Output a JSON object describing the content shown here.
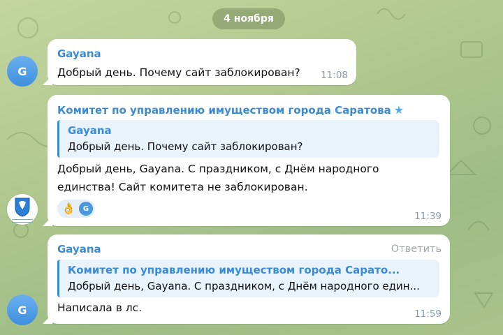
{
  "chat": {
    "date_separator": "4 ноября",
    "messages": [
      {
        "avatar_letter": "G",
        "sender": "Gayana",
        "text": "Добрый день. Почему сайт заблокирован?",
        "time": "11:08"
      },
      {
        "avatar_icon": "saratov-coat-of-arms-icon",
        "sender": "Комитет по управлению имуществом города Саратова",
        "sender_badge_icon": "star-icon",
        "reply_to": {
          "sender": "Gayana",
          "text": "Добрый день. Почему сайт заблокирован?"
        },
        "text_lines": [
          "Добрый день, Gayana. С праздником, с Днём народного",
          "единства! Сайт комитета не заблокирован."
        ],
        "reaction": {
          "emoji": "👌",
          "reactor_letter": "G"
        },
        "time": "11:39"
      },
      {
        "avatar_letter": "G",
        "sender": "Gayana",
        "reply_action": "Ответить",
        "reply_to": {
          "sender": "Комитет по управлению имуществом города Сарато...",
          "text": "Добрый день, Gayana. С праздником, с Днём народного един..."
        },
        "text": "Написала в лс.",
        "time": "11:59"
      }
    ]
  },
  "colors": {
    "accent": "#3a8bd4",
    "bubble": "#ffffff",
    "quote_bg": "#e9f3fc",
    "time": "#8a9aa5",
    "wallpaper": "#b2c98f"
  }
}
